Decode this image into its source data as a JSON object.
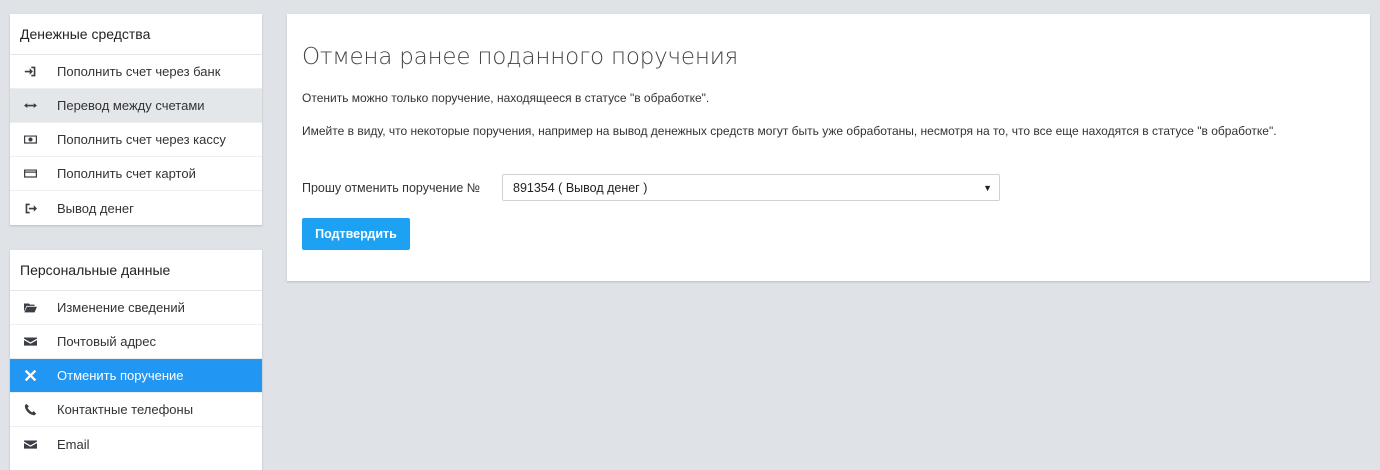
{
  "sidebar_money": {
    "title": "Денежные средства",
    "items": [
      {
        "label": "Пополнить счет через банк",
        "icon": "sign-in-icon"
      },
      {
        "label": "Перевод между счетами",
        "icon": "arrows-h-icon"
      },
      {
        "label": "Пополнить счет через кассу",
        "icon": "money-icon"
      },
      {
        "label": "Пополнить счет картой",
        "icon": "credit-card-icon"
      },
      {
        "label": "Вывод денег",
        "icon": "sign-out-icon"
      }
    ]
  },
  "sidebar_personal": {
    "title": "Персональные данные",
    "items": [
      {
        "label": "Изменение сведений",
        "icon": "folder-open-icon"
      },
      {
        "label": "Почтовый адрес",
        "icon": "envelope-icon"
      },
      {
        "label": "Отменить поручение",
        "icon": "close-icon"
      },
      {
        "label": "Контактные телефоны",
        "icon": "phone-icon"
      },
      {
        "label": "Email",
        "icon": "envelope-icon"
      }
    ]
  },
  "main": {
    "title": "Отмена ранее поданного поручения",
    "text1": "Отенить можно только поручение, находящееся в статусе \"в обработке\".",
    "text2": "Имейте в виду, что некоторые поручения, например на вывод денежных средств могут быть уже обработаны, несмотря на то, что все еще находятся в статусе \"в обработке\".",
    "form_label": "Прошу отменить поручение №",
    "selected_order": "891354 ( Вывод денег )",
    "confirm_label": "Подтвердить"
  },
  "colors": {
    "accent": "#2196f3",
    "button": "#1da1f2",
    "background": "#dfe3e8"
  }
}
